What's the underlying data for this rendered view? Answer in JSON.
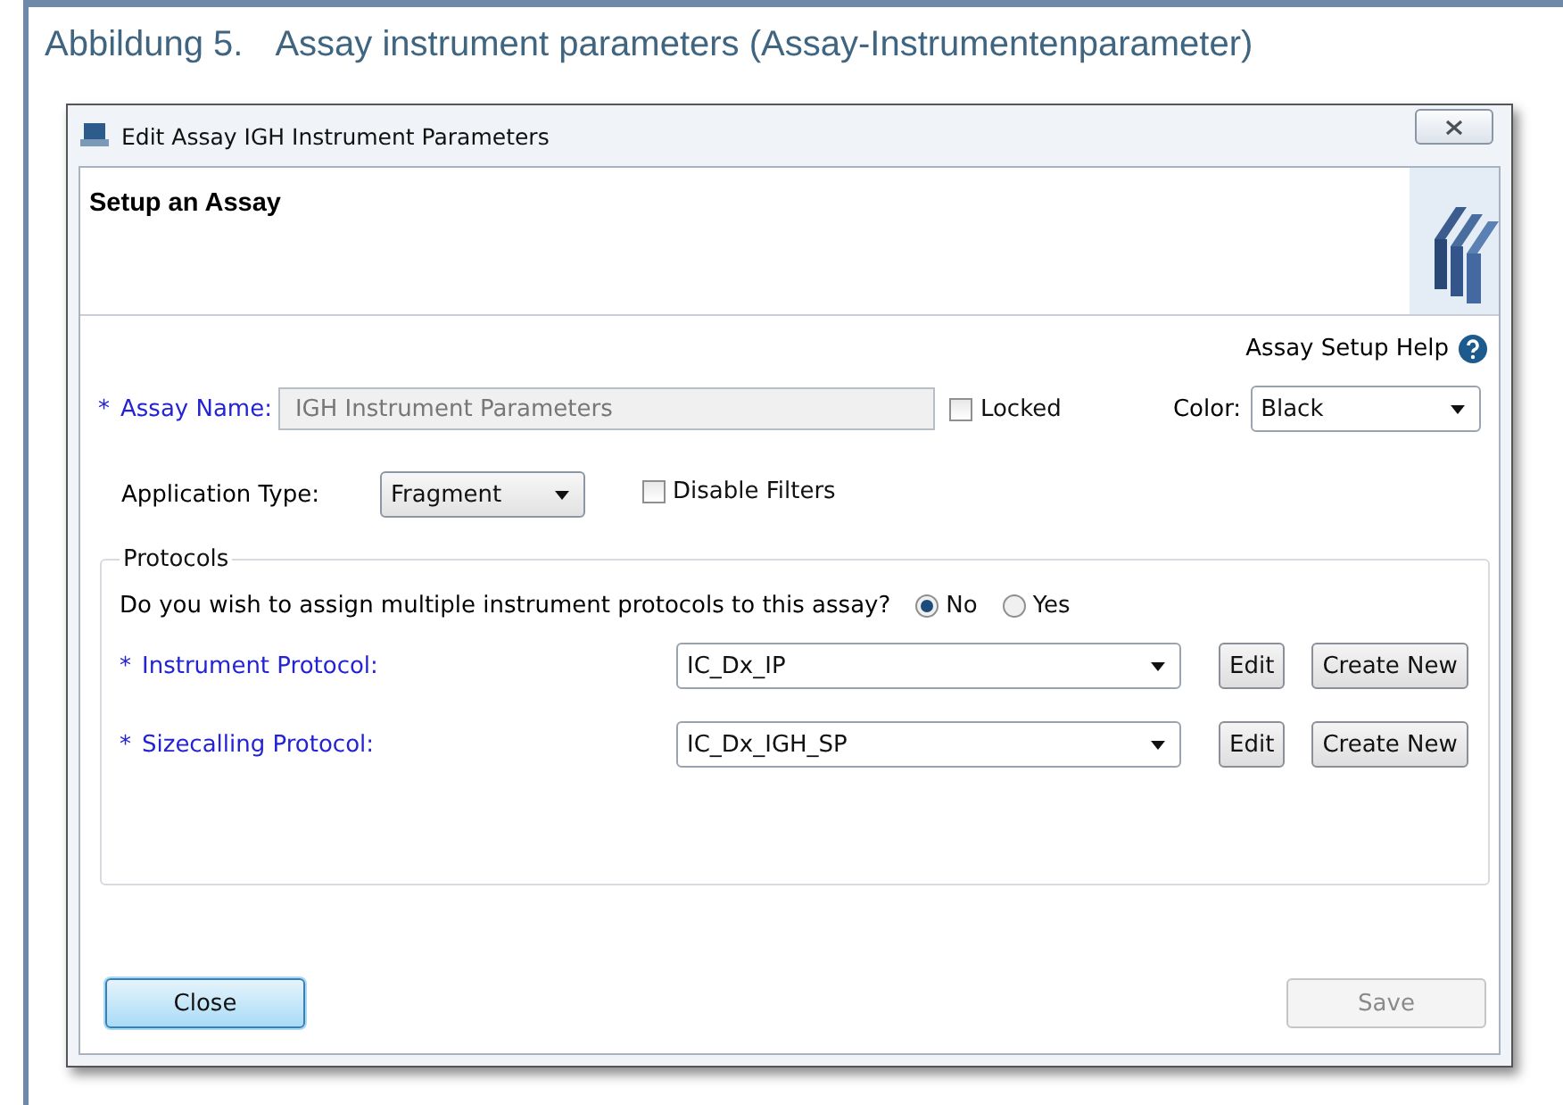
{
  "figure": {
    "label": "Abbildung 5.",
    "title": "Assay instrument parameters (Assay-Instrumentenparameter)"
  },
  "dialog": {
    "title": "Edit Assay IGH Instrument Parameters",
    "header": "Setup an Assay",
    "help": "Assay Setup Help",
    "assay_name": {
      "mark": "*",
      "label": "Assay Name:",
      "value": "IGH Instrument Parameters",
      "disabled": true
    },
    "locked": {
      "label": "Locked",
      "checked": false
    },
    "color": {
      "label": "Color:",
      "value": "Black"
    },
    "application_type": {
      "label": "Application Type:",
      "value": "Fragment"
    },
    "disable_filters": {
      "label": "Disable Filters",
      "checked": false
    },
    "protocols": {
      "legend": "Protocols",
      "question": "Do you wish to assign multiple instrument protocols to this assay?",
      "options": [
        {
          "label": "No",
          "selected": true
        },
        {
          "label": "Yes",
          "selected": false
        }
      ],
      "rows": [
        {
          "mark": "*",
          "label": "Instrument Protocol:",
          "value": "IC_Dx_IP",
          "buttons": [
            "Edit",
            "Create New"
          ]
        },
        {
          "mark": "*",
          "label": "Sizecalling Protocol:",
          "value": "IC_Dx_IGH_SP",
          "buttons": [
            "Edit",
            "Create New"
          ]
        }
      ]
    },
    "close": {
      "label": "Close",
      "focused": true
    },
    "save": {
      "label": "Save",
      "disabled": true
    }
  }
}
